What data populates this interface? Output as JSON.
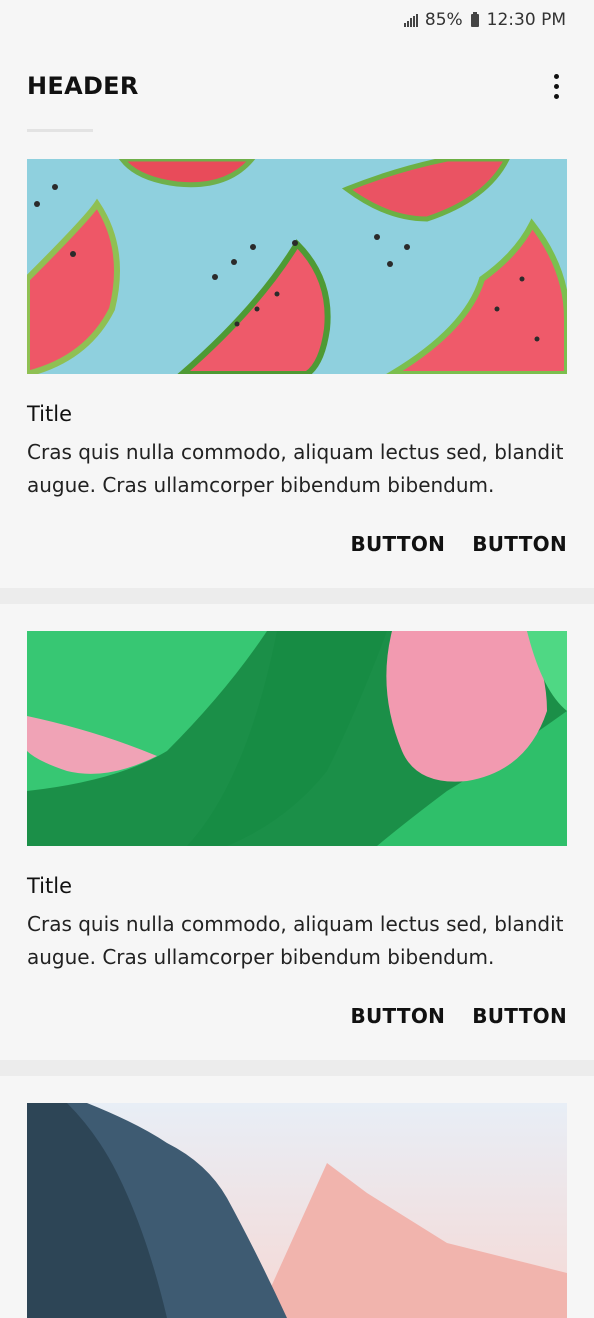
{
  "status_bar": {
    "battery": "85%",
    "time": "12:30 PM"
  },
  "header": {
    "title": "HEADER"
  },
  "cards": [
    {
      "title": "Title",
      "body": "Cras quis nulla commodo, aliquam lectus sed, blandit augue. Cras ullamcorper bibendum bibendum.",
      "button_1": "BUTTON",
      "button_2": "BUTTON"
    },
    {
      "title": "Title",
      "body": "Cras quis nulla commodo, aliquam lectus sed, blandit augue. Cras ullamcorper bibendum bibendum.",
      "button_1": "BUTTON",
      "button_2": "BUTTON"
    }
  ],
  "colors": {
    "background": "#f6f6f6",
    "divider": "#ececec",
    "watermelon_bg": "#8fd0de",
    "green_bg": "#2fbf6a",
    "pink": "#f2a0b4"
  },
  "icons": {
    "more": "more-vertical-icon",
    "signal": "signal-icon",
    "battery": "battery-icon"
  }
}
